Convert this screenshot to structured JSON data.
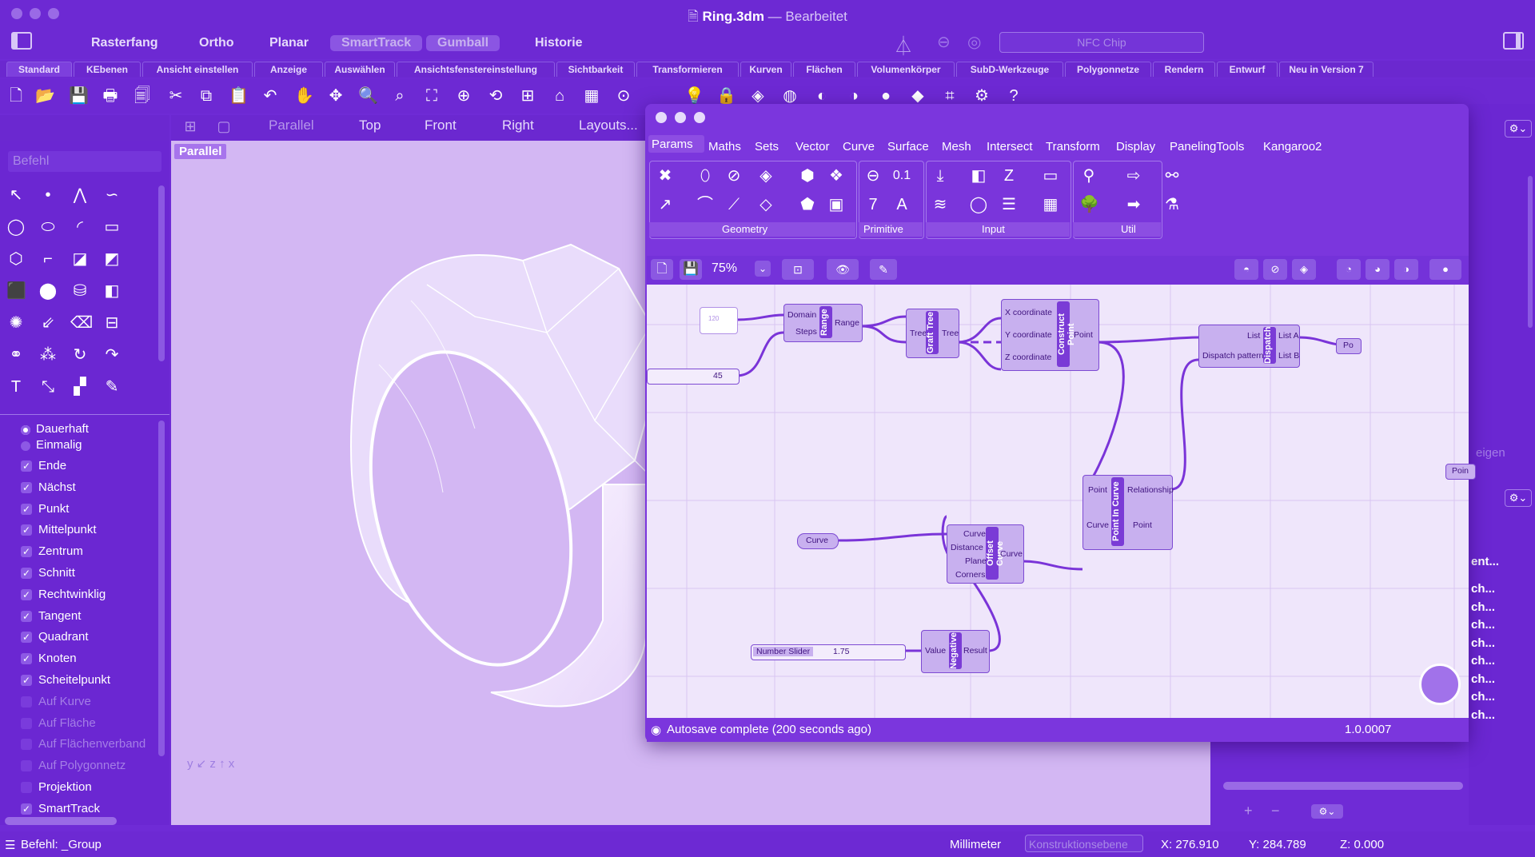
{
  "window": {
    "file": "Ring.3dm",
    "separator": "—",
    "state": "Bearbeitet"
  },
  "toolbar": {
    "items": [
      {
        "label": "Rasterfang",
        "on": false
      },
      {
        "label": "Ortho",
        "on": false
      },
      {
        "label": "Planar",
        "on": false
      },
      {
        "label": "SmartTrack",
        "on": true
      },
      {
        "label": "Gumball",
        "on": true
      },
      {
        "label": "Historie",
        "on": false
      }
    ],
    "nfc_placeholder": "NFC Chip"
  },
  "tabs": [
    "Standard",
    "KEbenen",
    "Ansicht einstellen",
    "Anzeige",
    "Auswählen",
    "Ansichtsfenstereinstellung",
    "Sichtbarkeit",
    "Transformieren",
    "Kurven",
    "Flächen",
    "Volumenkörper",
    "SubD-Werkzeuge",
    "Polygonnetze",
    "Rendern",
    "Entwurf",
    "Neu in Version 7"
  ],
  "viewport_tabs": [
    "Parallel",
    "Top",
    "Front",
    "Right",
    "Layouts..."
  ],
  "viewport_label": "Parallel",
  "command_placeholder": "Befehl",
  "osnap": {
    "radios": [
      {
        "label": "Dauerhaft",
        "selected": true
      },
      {
        "label": "Einmalig",
        "selected": false
      }
    ],
    "checks": [
      {
        "label": "Ende",
        "checked": true
      },
      {
        "label": "Nächst",
        "checked": true
      },
      {
        "label": "Punkt",
        "checked": true
      },
      {
        "label": "Mittelpunkt",
        "checked": true
      },
      {
        "label": "Zentrum",
        "checked": true
      },
      {
        "label": "Schnitt",
        "checked": true
      },
      {
        "label": "Rechtwinklig",
        "checked": true
      },
      {
        "label": "Tangent",
        "checked": true
      },
      {
        "label": "Quadrant",
        "checked": true
      },
      {
        "label": "Knoten",
        "checked": true
      },
      {
        "label": "Scheitelpunkt",
        "checked": true
      },
      {
        "label": "Auf Kurve",
        "checked": false
      },
      {
        "label": "Auf Fläche",
        "checked": false
      },
      {
        "label": "Auf Flächenverband",
        "checked": false
      },
      {
        "label": "Auf Polygonnetz",
        "checked": false
      },
      {
        "label": "Projektion",
        "checked": false
      },
      {
        "label": "SmartTrack",
        "checked": true
      }
    ]
  },
  "grasshopper": {
    "menus": [
      "Params",
      "Maths",
      "Sets",
      "Vector",
      "Curve",
      "Surface",
      "Mesh",
      "Intersect",
      "Transform",
      "Display",
      "PanelingTools",
      "Kangaroo2"
    ],
    "groups": [
      "Geometry",
      "Primitive",
      "Input",
      "Util"
    ],
    "zoom": "75%",
    "status": "Autosave complete (200 seconds ago)",
    "version": "1.0.0007",
    "nodes": {
      "panel_value": "120",
      "slider1_value": "45",
      "range": {
        "name": "Range",
        "inputs": [
          "Domain",
          "Steps"
        ],
        "outputs": [
          "Range"
        ]
      },
      "graft": {
        "name": "Graft Tree",
        "inputs": [
          "Tree"
        ],
        "outputs": [
          "Tree"
        ]
      },
      "construct": {
        "name": "Construct Point",
        "inputs": [
          "X coordinate",
          "Y coordinate",
          "Z coordinate"
        ],
        "outputs": [
          "Point"
        ]
      },
      "dispatch": {
        "name": "Dispatch",
        "inputs": [
          "List",
          "Dispatch pattern"
        ],
        "outputs": [
          "List A",
          "List B"
        ]
      },
      "curve_param": "Curve",
      "offset": {
        "name": "Offset Curve",
        "inputs": [
          "Curve",
          "Distance",
          "Plane",
          "Corners"
        ],
        "outputs": [
          "Curve"
        ]
      },
      "pic": {
        "name": "Point In Curve",
        "inputs": [
          "Point",
          "Curve"
        ],
        "outputs": [
          "Relationship",
          "Point"
        ]
      },
      "slider2_label": "Number Slider",
      "slider2_value": "1.75",
      "negative": {
        "name": "Negative",
        "inputs": [
          "Value"
        ],
        "outputs": [
          "Result"
        ]
      },
      "edge_labels": [
        "Po",
        "Poin"
      ]
    }
  },
  "right_fragments": {
    "zeigen": "eigen",
    "ent": "ent...",
    "rows": [
      "ch...",
      "ch...",
      "ch...",
      "ch...",
      "ch...",
      "ch...",
      "ch...",
      "ch..."
    ]
  },
  "statusbar": {
    "command": "Befehl: _Group",
    "units": "Millimeter",
    "cplane": "Konstruktionsebene",
    "x": "X: 276.910",
    "y": "Y: 284.789",
    "z": "Z: 0.000"
  },
  "colors": {
    "accent": "#6f2bd6",
    "viewport": "#d3b7f3",
    "canvas": "#efe6fb",
    "node": "#c8b0ef",
    "wire": "#7a34d8"
  }
}
